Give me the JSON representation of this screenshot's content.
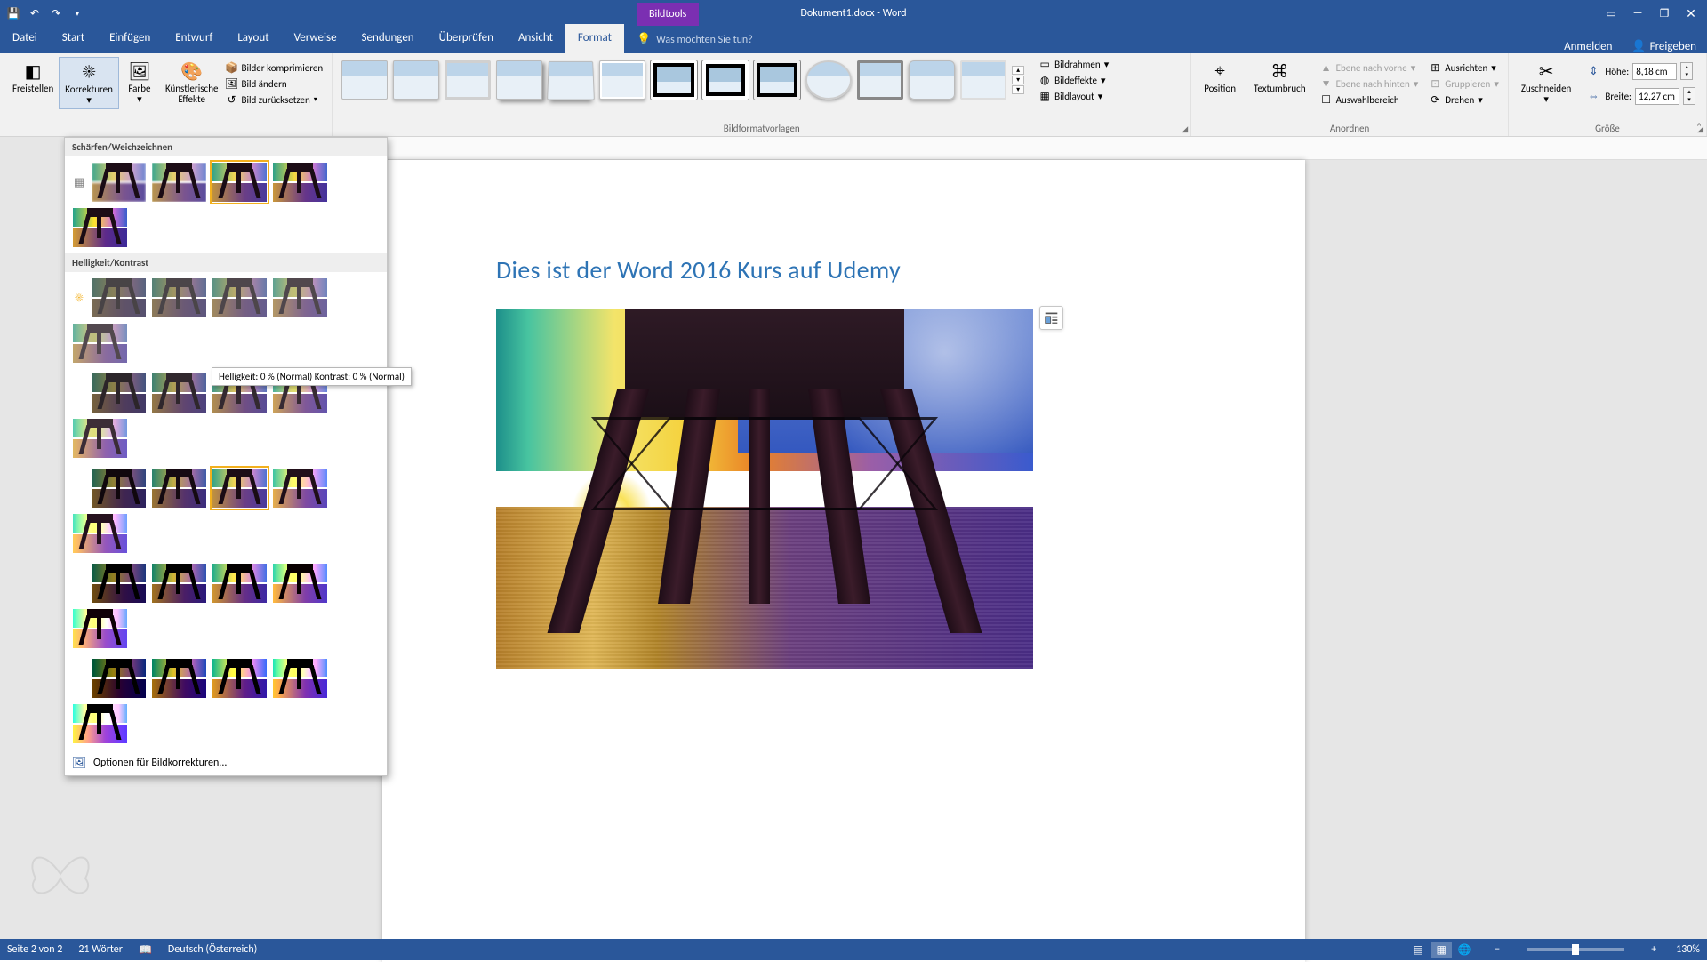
{
  "titlebar": {
    "context_tab": "Bildtools",
    "document_title": "Dokument1.docx - Word"
  },
  "tabs": {
    "datei": "Datei",
    "start": "Start",
    "einfuegen": "Einfügen",
    "entwurf": "Entwurf",
    "layout": "Layout",
    "verweise": "Verweise",
    "sendungen": "Sendungen",
    "ueberpruefen": "Überprüfen",
    "ansicht": "Ansicht",
    "format": "Format",
    "tellme_placeholder": "Was möchten Sie tun?",
    "anmelden": "Anmelden",
    "freigeben": "Freigeben"
  },
  "ribbon": {
    "freistellen": "Freistellen",
    "korrekturen": "Korrekturen",
    "farbe": "Farbe",
    "kuenstlerische": "Künstlerische\nEffekte",
    "komprimieren": "Bilder komprimieren",
    "aendern": "Bild ändern",
    "zuruecksetzen": "Bild zurücksetzen",
    "bildrahmen": "Bildrahmen",
    "bildeffekte": "Bildeffekte",
    "bildlayout": "Bildlayout",
    "grp_styles": "Bildformatvorlagen",
    "position": "Position",
    "textumbruch": "Textumbruch",
    "ebene_vorne": "Ebene nach vorne",
    "ebene_hinten": "Ebene nach hinten",
    "auswahlbereich": "Auswahlbereich",
    "ausrichten": "Ausrichten",
    "gruppieren": "Gruppieren",
    "drehen": "Drehen",
    "grp_anordnen": "Anordnen",
    "zuschneiden": "Zuschneiden",
    "hoehe_lbl": "Höhe:",
    "hoehe_val": "8,18 cm",
    "breite_lbl": "Breite:",
    "breite_val": "12,27 cm",
    "grp_groesse": "Größe"
  },
  "dropdown": {
    "schaerfen": "Schärfen/Weichzeichnen",
    "helligkeit": "Helligkeit/Kontrast",
    "optionen": "Optionen für Bildkorrekturen...",
    "tooltip": "Helligkeit: 0 % (Normal) Kontrast: 0 % (Normal)"
  },
  "document": {
    "heading": "Dies ist der Word 2016 Kurs auf Udemy"
  },
  "statusbar": {
    "page": "Seite 2 von 2",
    "words": "21 Wörter",
    "lang": "Deutsch (Österreich)",
    "zoom": "130%"
  }
}
